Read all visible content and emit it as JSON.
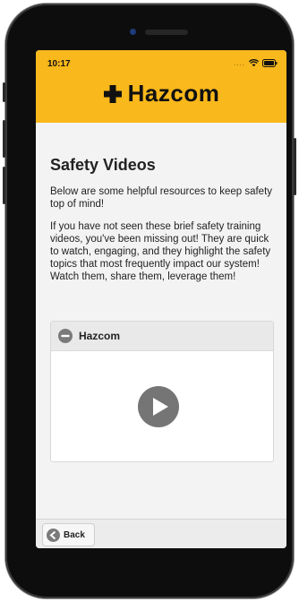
{
  "status_bar": {
    "time": "10:17",
    "signal": "....",
    "icons": [
      "wifi-icon",
      "battery-icon"
    ]
  },
  "header": {
    "brand_name": "Hazcom",
    "brand_icon": "plus-icon",
    "background_color": "#f9b81b"
  },
  "main": {
    "title": "Safety Videos",
    "paragraphs": [
      "Below are some helpful resources to keep safety top of mind!",
      "If you have not seen these brief safety training videos, you've been missing out! They are quick to watch, engaging, and they highlight the safety topics that most frequently impact our system! Watch them, share them, leverage them!"
    ]
  },
  "accordion": {
    "title": "Hazcom",
    "state_icon": "minus-circle-icon",
    "video_icon": "play-icon"
  },
  "footer": {
    "back_label": "Back"
  }
}
